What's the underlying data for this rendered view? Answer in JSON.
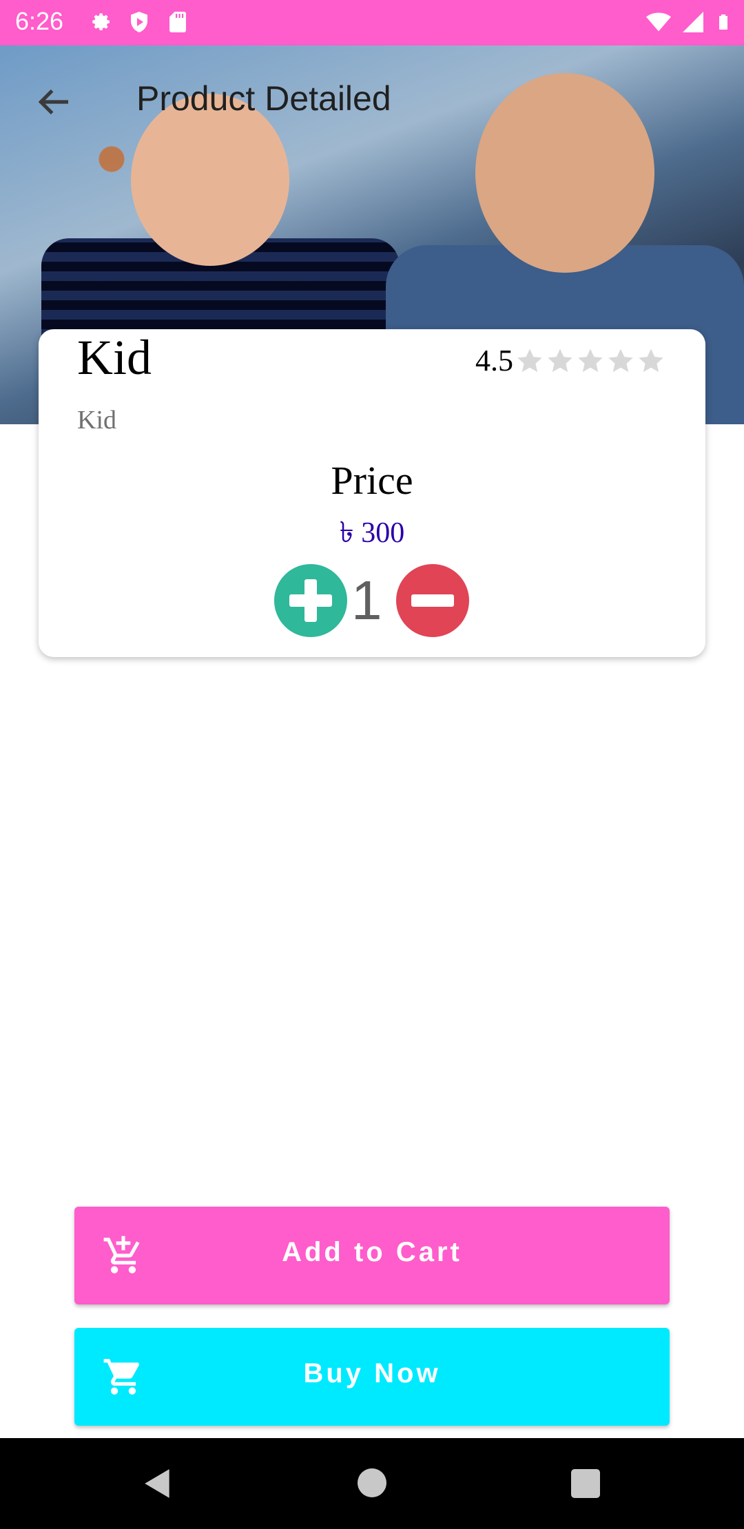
{
  "status_bar": {
    "time": "6:26",
    "icons": [
      "gear-icon",
      "shield-play-icon",
      "sd-card-icon",
      "wifi-icon",
      "signal-icon",
      "battery-icon"
    ]
  },
  "app_bar": {
    "title": "Product Detailed",
    "back_icon": "arrow-left-icon"
  },
  "product": {
    "name": "Kid",
    "subtitle": "Kid",
    "rating_value": "4.5",
    "rating_stars_filled": 0,
    "rating_stars_total": 5,
    "price_label": "Price",
    "price_value": "৳ 300",
    "quantity": "1"
  },
  "actions": {
    "add_to_cart": "Add to Cart",
    "buy_now": "Buy Now"
  },
  "colors": {
    "accent_pink": "#ff5ccc",
    "accent_cyan": "#00eaff",
    "plus_green": "#2fb89a",
    "minus_red": "#e04455",
    "price_blue": "#2a00a8"
  }
}
